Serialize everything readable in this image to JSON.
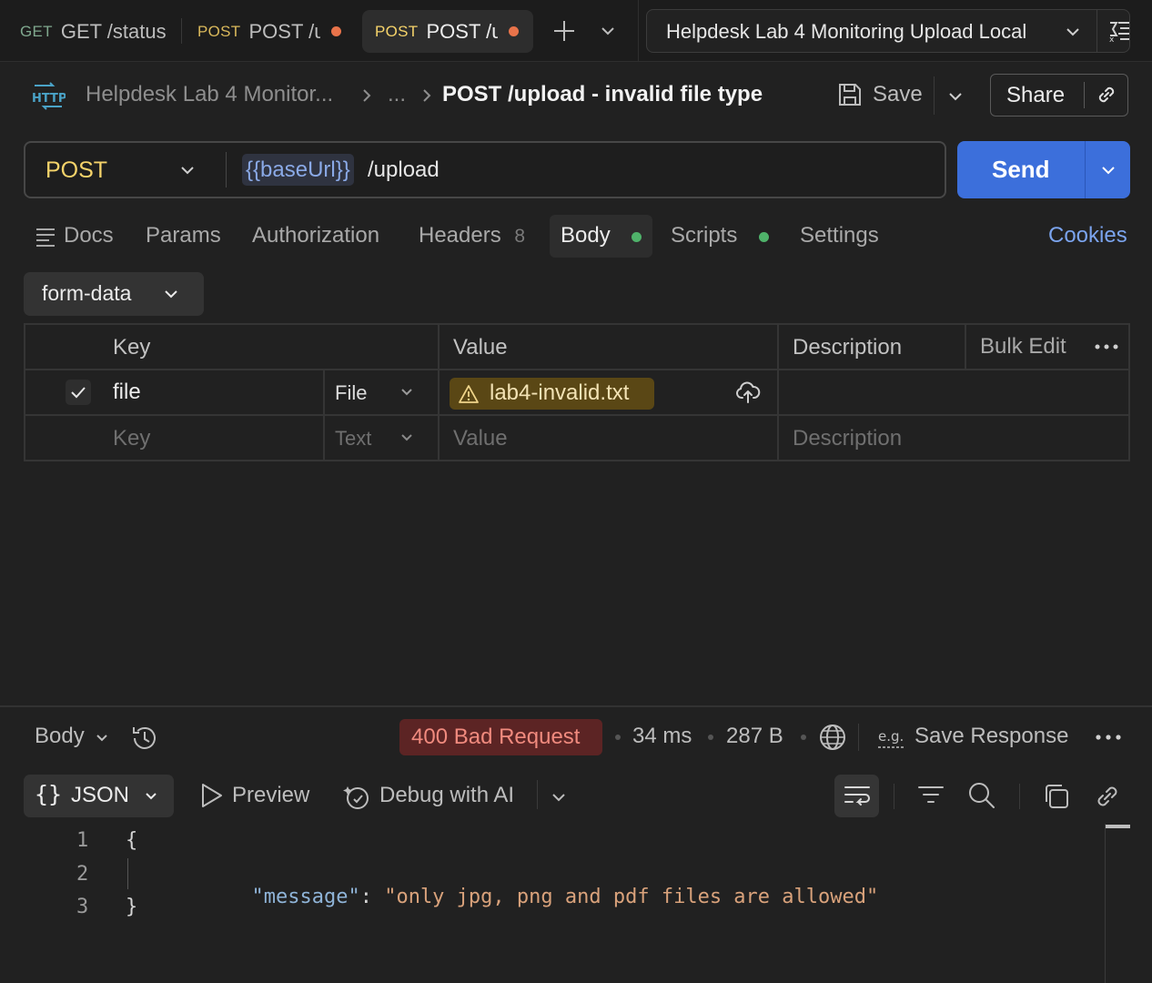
{
  "tabs": [
    {
      "method": "GET",
      "title": "GET /status",
      "unsaved": false,
      "active": false
    },
    {
      "method": "POST",
      "title": "POST /upload",
      "unsaved": true,
      "active": false
    },
    {
      "method": "POST",
      "title": "POST /upload",
      "unsaved": true,
      "active": true
    }
  ],
  "environment": {
    "name": "Helpdesk Lab 4 Monitoring Upload Local"
  },
  "breadcrumb": {
    "protocol_badge": "HTTP",
    "collection": "Helpdesk Lab 4 Monitor...",
    "ellipsis": "...",
    "request_name": "POST /upload - invalid file type"
  },
  "actions": {
    "save_label": "Save",
    "share_label": "Share"
  },
  "request": {
    "method": "POST",
    "url_variable": "{{baseUrl}}",
    "url_path": "/upload",
    "send_label": "Send"
  },
  "request_tabs": {
    "docs": "Docs",
    "params": "Params",
    "authorization": "Authorization",
    "headers": "Headers",
    "headers_count": "8",
    "body": "Body",
    "scripts": "Scripts",
    "settings": "Settings",
    "cookies": "Cookies"
  },
  "body": {
    "mode": "form-data",
    "columns": {
      "key": "Key",
      "value": "Value",
      "description": "Description",
      "bulk_edit": "Bulk Edit"
    },
    "rows": [
      {
        "checked": true,
        "key": "file",
        "type": "File",
        "value": "lab4-invalid.txt",
        "description": ""
      }
    ],
    "placeholder_row": {
      "key": "Key",
      "type": "Text",
      "value": "Value",
      "description": "Description"
    }
  },
  "response": {
    "section_label": "Body",
    "status": "400 Bad Request",
    "time": "34 ms",
    "size": "287 B",
    "save_response_label": "Save Response",
    "format": "JSON",
    "preview_label": "Preview",
    "debug_label": "Debug with AI",
    "code_lines": [
      {
        "num": "1",
        "text": "{"
      },
      {
        "num": "2",
        "key": "\"message\"",
        "colon": ": ",
        "value": "\"only jpg, png and pdf files are allowed\""
      },
      {
        "num": "3",
        "text": "}"
      }
    ]
  },
  "colors": {
    "accent_blue": "#3c6fdb",
    "post_method": "#f5d36a",
    "status_error_bg": "#5c2424",
    "status_error_text": "#f08a7e",
    "dot_green": "#4fb26a",
    "unsaved_dot": "#e8734a",
    "cookies_link": "#7ba4ee"
  }
}
